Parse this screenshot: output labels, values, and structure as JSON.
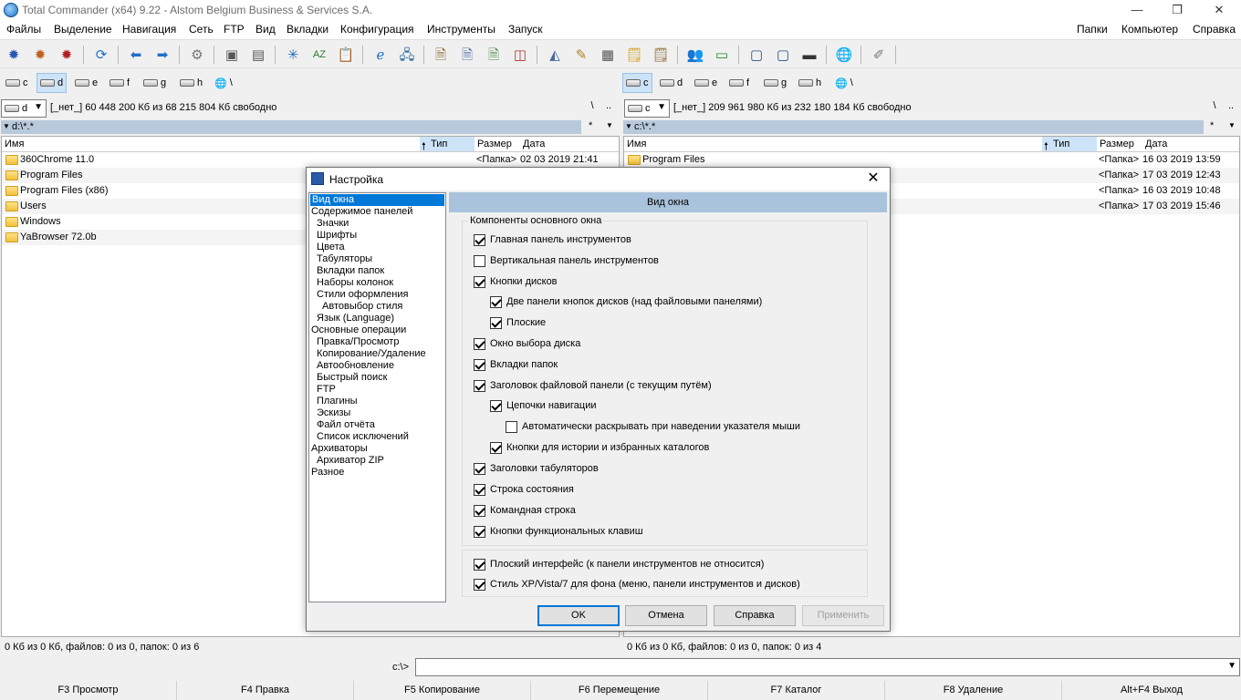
{
  "window": {
    "title": "Total Commander (x64) 9.22 - Alstom Belgium Business & Services S.A.",
    "minimize": "—",
    "maximize": "❐",
    "close": "✕"
  },
  "menu": {
    "left": [
      "Файлы",
      "Выделение",
      "Навигация",
      "Сеть",
      "FTP",
      "Вид",
      "Вкладки",
      "Конфигурация",
      "Инструменты",
      "Запуск"
    ],
    "right": [
      "Папки",
      "Компьютер",
      "Справка"
    ]
  },
  "toolbar_icons": [
    "gear-icon",
    "gear-icon",
    "gear-icon",
    "refresh-icon",
    "arrow-left-icon",
    "arrow-right-icon",
    "settings-icon",
    "pack-icon",
    "unpack-icon",
    "sparkle-icon",
    "sort-az-icon",
    "clipboard-icon",
    "ie-icon",
    "network-icon",
    "document-icon",
    "document-icon",
    "document-icon",
    "compare-icon",
    "eraser-icon",
    "brush-icon",
    "calculator-icon",
    "note-icon",
    "notepad-icon",
    "users-icon",
    "drive-icon",
    "window-icon",
    "window-icon",
    "terminal-icon",
    "globe-icon",
    "tool-icon"
  ],
  "left_panel": {
    "drives": [
      "c",
      "d",
      "e",
      "f",
      "g",
      "h",
      "\\"
    ],
    "active_drive": "d",
    "combo_drive": "d",
    "free_info": "[_нет_]  60 448 200 Кб из 68 215 804 Кб свободно",
    "btn_root": "\\",
    "btn_up": "..",
    "path": "d:\\*.*",
    "star": "*",
    "columns": {
      "name": "Имя",
      "type": "Тип",
      "size": "Размер",
      "date": "Дата"
    },
    "files": [
      {
        "name": "360Chrome 11.0",
        "type": "<Папка>",
        "date": "02 03 2019 21:41"
      },
      {
        "name": "Program Files",
        "type": "",
        "date": ""
      },
      {
        "name": "Program Files (x86)",
        "type": "",
        "date": ""
      },
      {
        "name": "Users",
        "type": "",
        "date": ""
      },
      {
        "name": "Windows",
        "type": "",
        "date": ""
      },
      {
        "name": "YaBrowser 72.0b",
        "type": "",
        "date": ""
      }
    ],
    "status": "0 Кб из 0 Кб, файлов: 0 из 0, папок: 0 из 6"
  },
  "right_panel": {
    "drives": [
      "c",
      "d",
      "e",
      "f",
      "g",
      "h",
      "\\"
    ],
    "active_drive": "c",
    "combo_drive": "c",
    "free_info": "[_нет_]  209 961 980 Кб из 232 180 184 Кб свободно",
    "btn_root": "\\",
    "btn_up": "..",
    "path": "c:\\*.*",
    "star": "*",
    "columns": {
      "name": "Имя",
      "type": "Тип",
      "size": "Размер",
      "date": "Дата"
    },
    "files": [
      {
        "name": "Program Files",
        "type": "<Папка>",
        "date": "16 03 2019 13:59"
      },
      {
        "name": "",
        "type": "<Папка>",
        "date": "17 03 2019 12:43"
      },
      {
        "name": "",
        "type": "<Папка>",
        "date": "16 03 2019 10:48"
      },
      {
        "name": "",
        "type": "<Папка>",
        "date": "17 03 2019 15:46"
      }
    ],
    "status": "0 Кб из 0 Кб, файлов: 0 из 0, папок: 0 из 4"
  },
  "command": {
    "label": "c:\\>",
    "value": ""
  },
  "fkeys": [
    "F3 Просмотр",
    "F4 Правка",
    "F5 Копирование",
    "F6 Перемещение",
    "F7 Каталог",
    "F8 Удаление",
    "Alt+F4 Выход"
  ],
  "dialog": {
    "title": "Настройка",
    "close": "✕",
    "tree": [
      {
        "label": "Вид окна",
        "level": 0,
        "selected": true
      },
      {
        "label": "Содержимое панелей",
        "level": 0
      },
      {
        "label": "Значки",
        "level": 1
      },
      {
        "label": "Шрифты",
        "level": 1
      },
      {
        "label": "Цвета",
        "level": 1
      },
      {
        "label": "Табуляторы",
        "level": 1
      },
      {
        "label": "Вкладки папок",
        "level": 1
      },
      {
        "label": "Наборы колонок",
        "level": 1
      },
      {
        "label": "Стили оформления",
        "level": 1
      },
      {
        "label": "Автовыбор стиля",
        "level": 2
      },
      {
        "label": "Язык (Language)",
        "level": 1
      },
      {
        "label": "Основные операции",
        "level": 0
      },
      {
        "label": "Правка/Просмотр",
        "level": 1
      },
      {
        "label": "Копирование/Удаление",
        "level": 1
      },
      {
        "label": "Автообновление",
        "level": 1
      },
      {
        "label": "Быстрый поиск",
        "level": 1
      },
      {
        "label": "FTP",
        "level": 1
      },
      {
        "label": "Плагины",
        "level": 1
      },
      {
        "label": "Эскизы",
        "level": 1
      },
      {
        "label": "Файл отчёта",
        "level": 1
      },
      {
        "label": "Список исключений",
        "level": 1
      },
      {
        "label": "Архиваторы",
        "level": 0
      },
      {
        "label": "Архиватор ZIP",
        "level": 1
      },
      {
        "label": "Разное",
        "level": 0
      }
    ],
    "page_header": "Вид окна",
    "group_label": "Компоненты основного окна",
    "options": [
      {
        "label": "Главная панель инструментов",
        "checked": true,
        "indent": 0
      },
      {
        "label": "Вертикальная панель инструментов",
        "checked": false,
        "indent": 0
      },
      {
        "label": "Кнопки дисков",
        "checked": true,
        "indent": 0
      },
      {
        "label": "Две панели кнопок дисков (над файловыми панелями)",
        "checked": true,
        "indent": 1
      },
      {
        "label": "Плоские",
        "checked": true,
        "indent": 1
      },
      {
        "label": "Окно выбора диска",
        "checked": true,
        "indent": 0
      },
      {
        "label": "Вкладки папок",
        "checked": true,
        "indent": 0
      },
      {
        "label": "Заголовок файловой панели (с текущим путём)",
        "checked": true,
        "indent": 0
      },
      {
        "label": "Цепочки навигации",
        "checked": true,
        "indent": 1
      },
      {
        "label": "Автоматически раскрывать при наведении указателя мыши",
        "checked": false,
        "indent": 2
      },
      {
        "label": "Кнопки для истории и избранных каталогов",
        "checked": true,
        "indent": 1
      },
      {
        "label": "Заголовки табуляторов",
        "checked": true,
        "indent": 0
      },
      {
        "label": "Строка состояния",
        "checked": true,
        "indent": 0
      },
      {
        "label": "Командная строка",
        "checked": true,
        "indent": 0
      },
      {
        "label": "Кнопки функциональных клавиш",
        "checked": true,
        "indent": 0
      }
    ],
    "extra_options": [
      {
        "label": "Плоский интерфейс (к панели инструментов не относится)",
        "checked": true
      },
      {
        "label": "Стиль XP/Vista/7 для фона (меню, панели инструментов и дисков)",
        "checked": true
      }
    ],
    "buttons": {
      "ok": "OK",
      "cancel": "Отмена",
      "help": "Справка",
      "apply": "Применить"
    }
  }
}
